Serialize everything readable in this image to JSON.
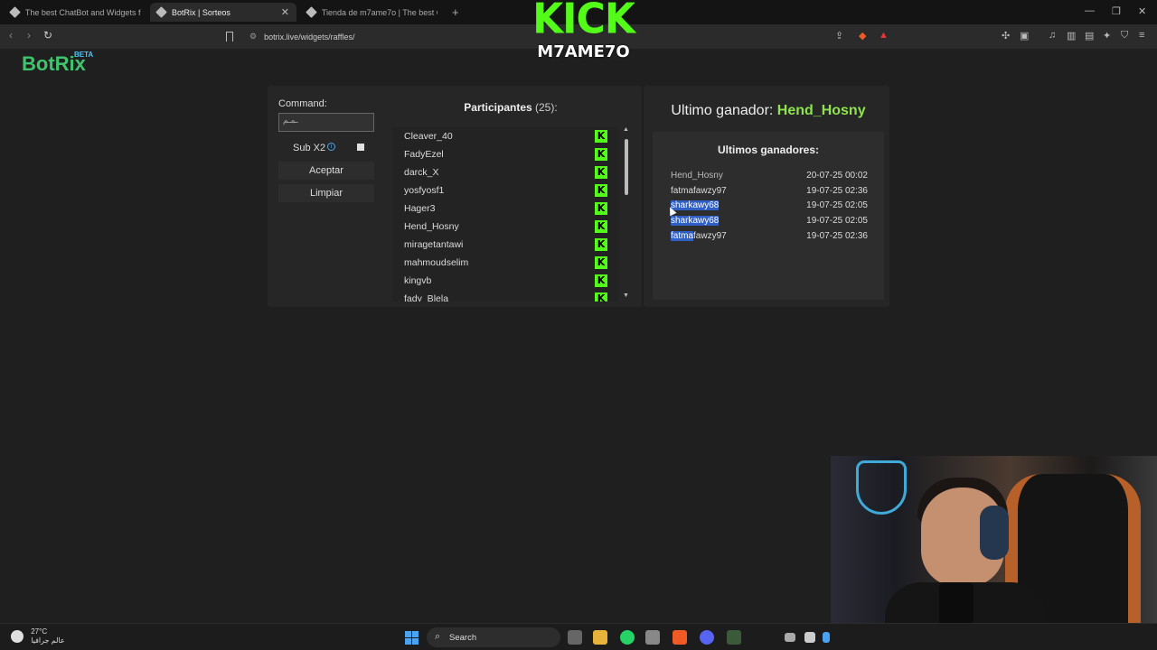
{
  "browser": {
    "tabs": [
      {
        "label": "The best ChatBot and Widgets for Ki"
      },
      {
        "label": "BotRix | Sorteos"
      },
      {
        "label": "Tienda de m7ame7o | The best ChatB"
      }
    ],
    "url": "botrix.live/widgets/raffles/"
  },
  "overlay": {
    "kick_text": "KICK",
    "channel": "M7AME7O"
  },
  "brand": {
    "name": "BotRix",
    "badge": "BETA"
  },
  "raffle": {
    "command_label": "Command:",
    "command_value": "ـمـم",
    "sub_label": "Sub X2",
    "accept_label": "Aceptar",
    "clear_label": "Limpiar",
    "participants_title": "Participantes",
    "participants_count": "(25):",
    "participants": [
      "Cleaver_40",
      "FadyEzel",
      "darck_X",
      "yosfyosf1",
      "Hager3",
      "Hend_Hosny",
      "miragetantawi",
      "mahmoudselim",
      "kingvb",
      "fady_Blela"
    ]
  },
  "winners": {
    "last_label": "Ultimo ganador:",
    "last_name": "Hend_Hosny",
    "list_title": "Ultimos ganadores:",
    "rows": [
      {
        "name": "Hend_Hosny",
        "date": "20-07-25 00:02"
      },
      {
        "name": "fatmafawzy97",
        "date": "19-07-25 02:36"
      },
      {
        "name": "sharkawy68",
        "date": "19-07-25 02:05"
      },
      {
        "name": "sharkawy68",
        "date": "19-07-25 02:05"
      },
      {
        "name_hl": "fatma",
        "name_rest": "fawzy97",
        "date": "19-07-25 02:36"
      }
    ]
  },
  "taskbar": {
    "temp": "27°C",
    "weather_text": "عالم جرافيا",
    "search_label": "Search"
  },
  "colors": {
    "kick_green": "#53fc18",
    "brand_green": "#3ec46d",
    "winner_green": "#8ee34f",
    "highlight": "#2f5fc4"
  }
}
